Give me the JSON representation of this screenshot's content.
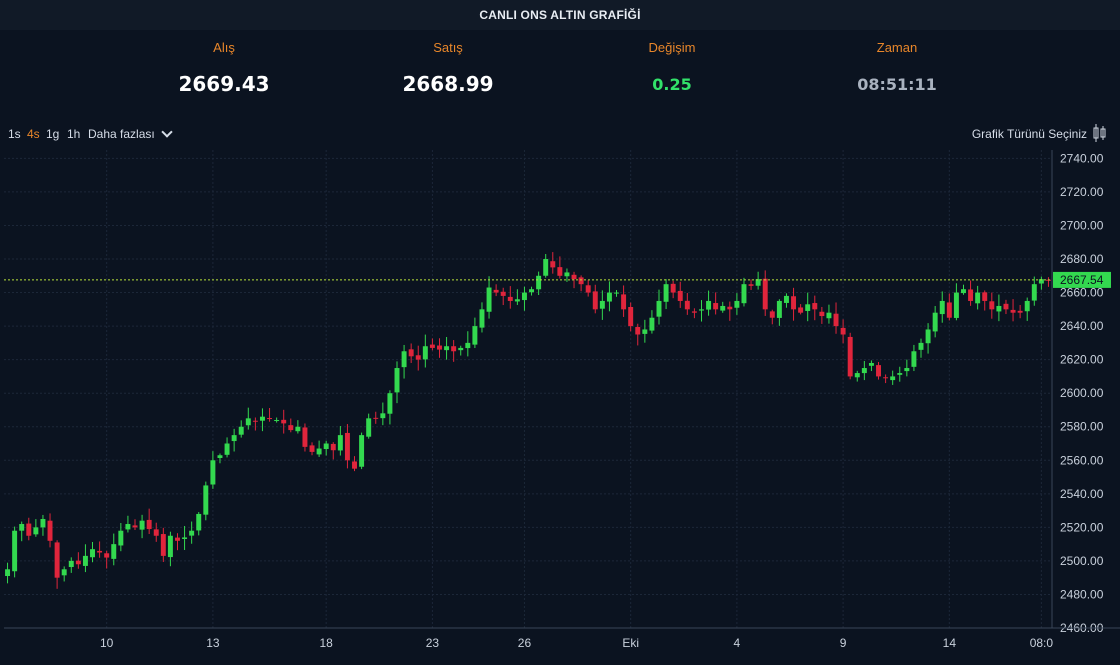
{
  "header": {
    "title": "CANLI ONS ALTIN GRAFİĞİ"
  },
  "stats": [
    {
      "label": "Alış",
      "value": "2669.43"
    },
    {
      "label": "Satış",
      "value": "2668.99"
    },
    {
      "label": "Değişim",
      "value": "0.25"
    },
    {
      "label": "Zaman",
      "value": "08:51:11"
    }
  ],
  "toolbar": {
    "timeframes": [
      "1s",
      "4s",
      "1g",
      "1h"
    ],
    "active_timeframe": "4s",
    "more_label": "Daha fazlası",
    "chart_type_label": "Grafik Türünü Seçiniz"
  },
  "colors": {
    "up": "#33d94f",
    "down": "#e0253c",
    "accent": "#e8862a",
    "change_positive": "#32e26a",
    "last_price_bg": "#33d94f"
  },
  "chart_data": {
    "type": "candlestick",
    "title": "",
    "ylim": [
      2460,
      2745
    ],
    "y_ticks": [
      "2740.00",
      "2720.00",
      "2700.00",
      "2680.00",
      "2660.00",
      "2640.00",
      "2620.00",
      "2600.00",
      "2580.00",
      "2560.00",
      "2540.00",
      "2520.00",
      "2500.00",
      "2480.00",
      "2460.00"
    ],
    "x_ticks": [
      "10",
      "13",
      "18",
      "23",
      "26",
      "Eki",
      "4",
      "9",
      "14",
      "08:0"
    ],
    "last_price": "2667.54",
    "grid": true,
    "close_series_approx": [
      2495,
      2518,
      2522,
      2515,
      2520,
      2525,
      2512,
      2490,
      2495,
      2500,
      2498,
      2503,
      2507,
      2505,
      2502,
      2510,
      2518,
      2522,
      2520,
      2524,
      2519,
      2515,
      2503,
      2515,
      2512,
      2514,
      2518,
      2528,
      2545,
      2560,
      2563,
      2570,
      2575,
      2580,
      2585,
      2583,
      2586,
      2585,
      2584,
      2582,
      2578,
      2580,
      2568,
      2565,
      2567,
      2570,
      2566,
      2575,
      2560,
      2555,
      2575,
      2585,
      2585,
      2588,
      2600,
      2615,
      2625,
      2622,
      2620,
      2628,
      2627,
      2626,
      2628,
      2625,
      2627,
      2630,
      2640,
      2650,
      2663,
      2660,
      2658,
      2655,
      2656,
      2660,
      2662,
      2670,
      2680,
      2675,
      2670,
      2672,
      2668,
      2665,
      2660,
      2650,
      2655,
      2660,
      2660,
      2650,
      2640,
      2635,
      2638,
      2645,
      2655,
      2665,
      2660,
      2655,
      2650,
      2648,
      2650,
      2655,
      2650,
      2652,
      2650,
      2655,
      2665,
      2664,
      2668,
      2650,
      2645,
      2655,
      2658,
      2650,
      2648,
      2653,
      2650,
      2646,
      2648,
      2640,
      2635,
      2610,
      2612,
      2615,
      2618,
      2610,
      2609,
      2610,
      2612,
      2615,
      2625,
      2630,
      2638,
      2648,
      2655,
      2645,
      2660,
      2662,
      2655,
      2660,
      2655,
      2650,
      2652,
      2650,
      2648,
      2648,
      2655,
      2665,
      2668,
      2667.54
    ]
  }
}
